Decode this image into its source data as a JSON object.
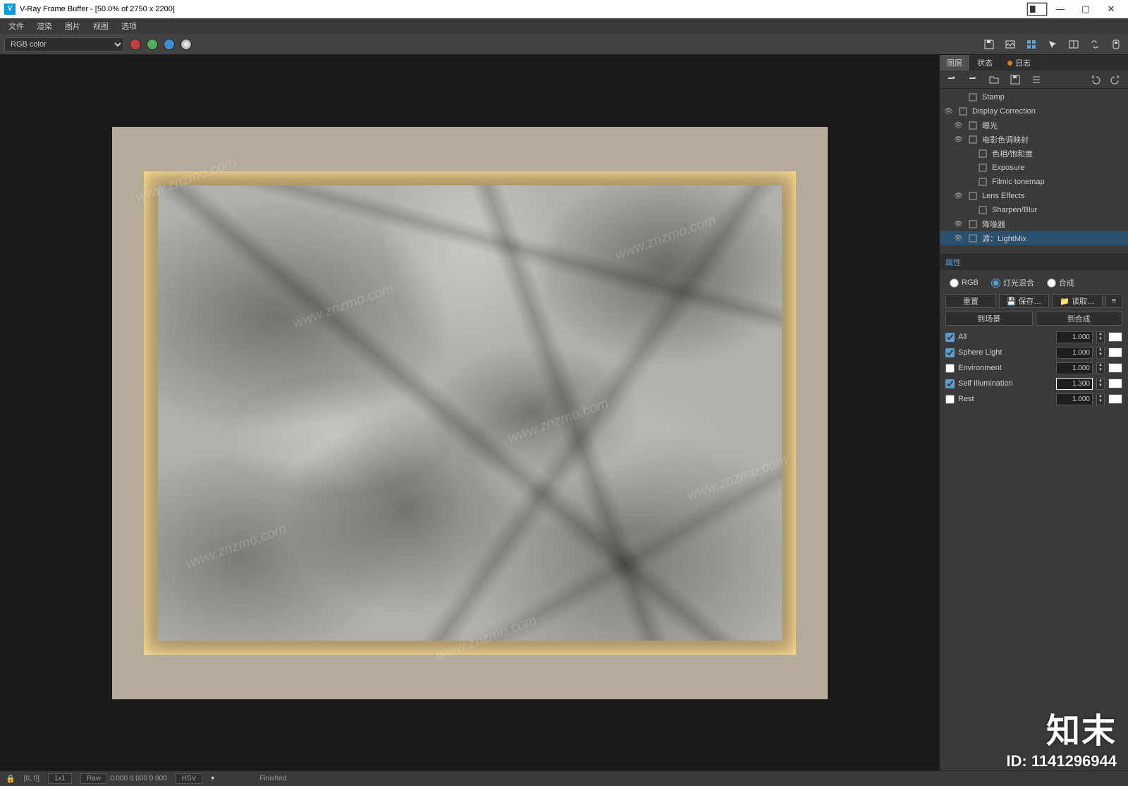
{
  "title": "V-Ray Frame Buffer - [50.0% of 2750 x 2200]",
  "menus": {
    "file": "文件",
    "render": "渲染",
    "image": "图片",
    "view": "视图",
    "options": "选项"
  },
  "channel": "RGB color",
  "colors": {
    "red": "#c04040",
    "green": "#50b060",
    "blue": "#4090d0"
  },
  "tabs": {
    "layers": "图层",
    "state": "状态",
    "log": "日志"
  },
  "layers": [
    {
      "name": "Stamp",
      "eye": false,
      "icon": "stamp",
      "indent": 1
    },
    {
      "name": "Display Correction",
      "eye": true,
      "icon": "dc",
      "indent": 0
    },
    {
      "name": "曝光",
      "eye": true,
      "icon": "exp",
      "indent": 1
    },
    {
      "name": "电影色调映射",
      "eye": true,
      "icon": "film",
      "indent": 1
    },
    {
      "name": "色相/饱和度",
      "eye": false,
      "icon": "hue",
      "indent": 2
    },
    {
      "name": "Exposure",
      "eye": false,
      "icon": "exp2",
      "indent": 2
    },
    {
      "name": "Filmic tonemap",
      "eye": false,
      "icon": "fm",
      "indent": 2
    },
    {
      "name": "Lens Effects",
      "eye": true,
      "icon": "lens",
      "indent": 1
    },
    {
      "name": "Sharpen/Blur",
      "eye": false,
      "icon": "sb",
      "indent": 2
    },
    {
      "name": "降噪器",
      "eye": true,
      "icon": "dn",
      "indent": 1
    },
    {
      "name": "源：LightMix",
      "eye": true,
      "icon": "lm",
      "indent": 1,
      "sel": true
    }
  ],
  "props": {
    "header": "属性",
    "radios": {
      "rgb": "RGB",
      "lightmix": "灯光混合",
      "composite": "合成"
    },
    "buttons": {
      "reset": "重置",
      "save": "保存…",
      "load": "读取…",
      "menu": "≡"
    },
    "buttons2": {
      "toScene": "到场景",
      "toComposite": "到合成"
    },
    "lights": [
      {
        "name": "All",
        "value": "1.000",
        "checked": true,
        "swatch": "#ffffff"
      },
      {
        "name": "Sphere Light",
        "value": "1.000",
        "checked": true,
        "swatch": "#ffffff"
      },
      {
        "name": "Environment",
        "value": "1.000",
        "checked": false,
        "swatch": "#ffffff"
      },
      {
        "name": "Self Illumination",
        "value": "1.300",
        "checked": true,
        "swatch": "#ffffff",
        "highlight": true
      },
      {
        "name": "Rest",
        "value": "1.000",
        "checked": false,
        "swatch": "#ffffff"
      }
    ],
    "saveIcon": "💾",
    "loadIcon": "📁"
  },
  "status": {
    "coords": "[0, 0]",
    "zoom": "1x1",
    "raw": "Raw",
    "rawVals": "0.000   0.000   0.000",
    "hsv": "HSV",
    "finished": "Finished"
  },
  "watermark": "www.znzmo.com",
  "branding": {
    "cn": "知末",
    "id": "ID: 1141296944"
  }
}
